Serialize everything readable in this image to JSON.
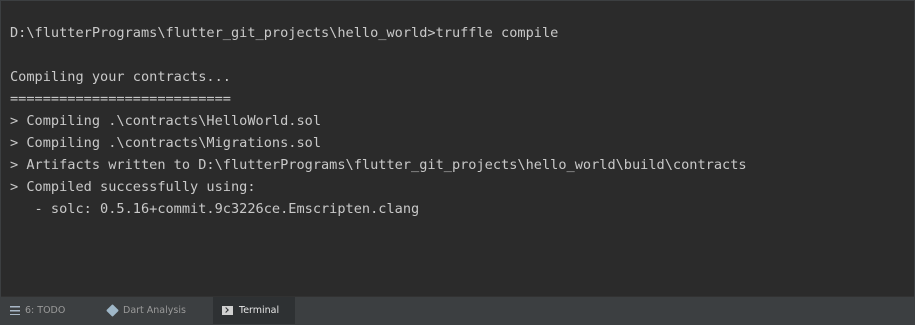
{
  "terminal": {
    "lines": [
      "D:\\flutterPrograms\\flutter_git_projects\\hello_world>truffle compile",
      "",
      "Compiling your contracts...",
      "===========================",
      "> Compiling .\\contracts\\HelloWorld.sol",
      "> Compiling .\\contracts\\Migrations.sol",
      "> Artifacts written to D:\\flutterPrograms\\flutter_git_projects\\hello_world\\build\\contracts",
      "> Compiled successfully using:",
      "   - solc: 0.5.16+commit.9c3226ce.Emscripten.clang"
    ]
  },
  "bottom_bar": {
    "tabs": [
      {
        "label": "6: TODO",
        "icon": "list-icon",
        "active": false
      },
      {
        "label": "Dart Analysis",
        "icon": "dart-icon",
        "active": false
      },
      {
        "label": "Terminal",
        "icon": "terminal-icon",
        "active": true
      }
    ]
  },
  "colors": {
    "background": "#2b2b2b",
    "text": "#c9c9c9",
    "toolbar": "#3c3f41"
  }
}
